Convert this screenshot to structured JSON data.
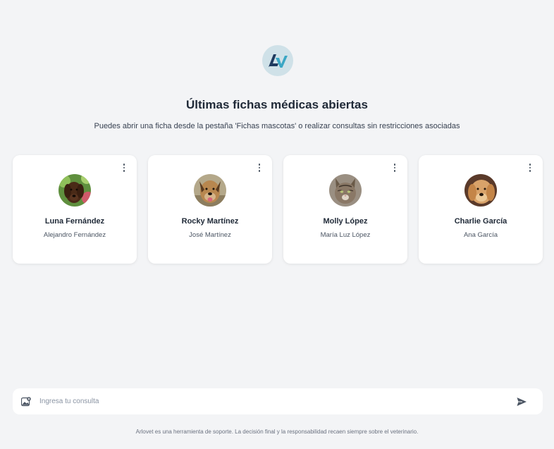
{
  "header": {
    "logo_icon": "arlovet-logo-icon",
    "title": "Últimas fichas médicas abiertas",
    "subtitle": "Puedes abrir una ficha desde la pestaña 'Fichas mascotas' o realizar consultas sin restricciones asociadas"
  },
  "cards": [
    {
      "pet": "Luna Fernández",
      "owner": "Alejandro Fernández",
      "avatar": "brown-labrador-photo"
    },
    {
      "pet": "Rocky Martínez",
      "owner": "José Martínez",
      "avatar": "tan-dog-photo"
    },
    {
      "pet": "Molly López",
      "owner": "María Luz López",
      "avatar": "tabby-cat-photo"
    },
    {
      "pet": "Charlie García",
      "owner": "Ana García",
      "avatar": "golden-retriever-photo"
    }
  ],
  "query": {
    "placeholder": "Ingresa tu consulta",
    "attach_icon": "image-attach-icon",
    "send_icon": "send-icon"
  },
  "footer": {
    "disclaimer": "Arlovet es una herramienta de soporte. La decisión final y la responsabilidad recaen siempre sobre el veterinario."
  },
  "colors": {
    "background": "#f3f4f6",
    "card": "#ffffff",
    "logo_bg": "#cfe1e8",
    "logo_dark": "#1e3a5f",
    "logo_accent": "#3aa6c4"
  }
}
